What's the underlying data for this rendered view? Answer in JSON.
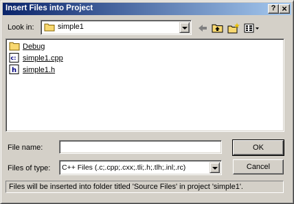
{
  "window": {
    "title": "Insert Files into Project",
    "help_button": "?",
    "close_button": "×"
  },
  "look_in": {
    "label": "Look in:",
    "value": "simple1",
    "icon": "folder-icon"
  },
  "toolbar": {
    "back_icon": "back-arrow-icon",
    "up_icon": "up-folder-icon",
    "new_folder_icon": "new-folder-icon",
    "view_icon": "view-menu-icon"
  },
  "files": [
    {
      "name": "Debug",
      "icon": "folder-icon"
    },
    {
      "name": "simple1.cpp",
      "icon": "cpp-file-icon"
    },
    {
      "name": "simple1.h",
      "icon": "header-file-icon"
    }
  ],
  "file_name": {
    "label": "File name:",
    "value": ""
  },
  "file_type": {
    "label": "Files of type:",
    "value": "C++ Files (.c;.cpp;.cxx;.tli;.h;.tlh;.inl;.rc)"
  },
  "buttons": {
    "ok": "OK",
    "cancel": "Cancel"
  },
  "status": "Files will be inserted into folder titled 'Source Files' in project 'simple1'.",
  "colors": {
    "face": "#d4d0c8",
    "title_start": "#0a246a",
    "title_end": "#a6caf0",
    "folder": "#f8d870"
  }
}
